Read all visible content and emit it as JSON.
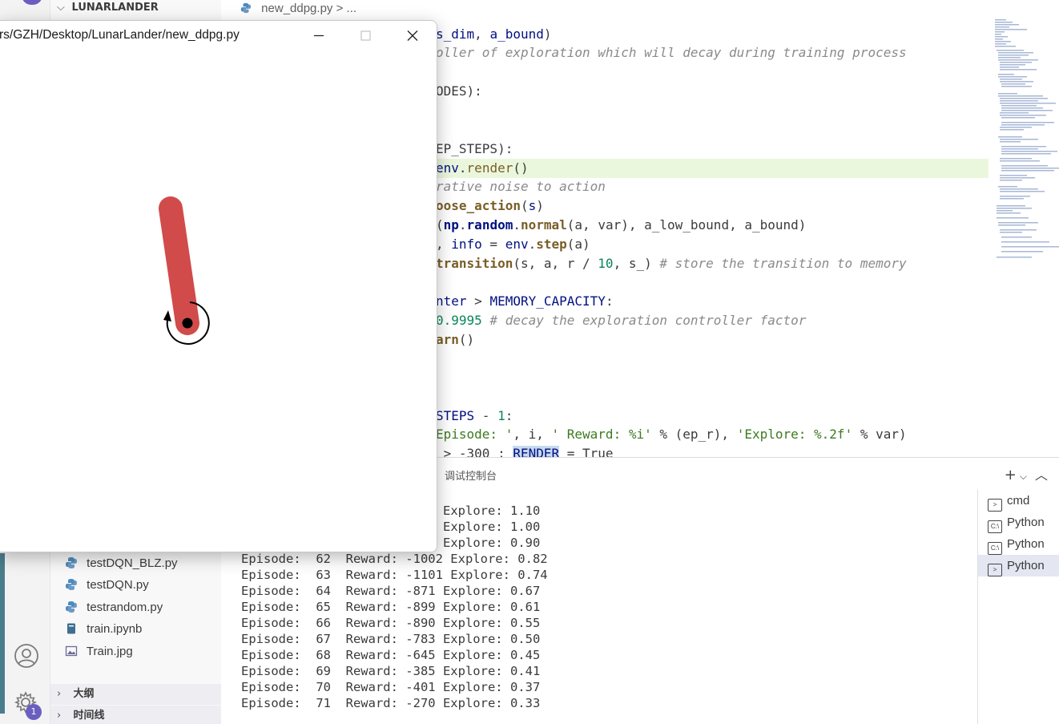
{
  "sidebar": {
    "root_folder": "LUNARLANDER",
    "files": [
      {
        "name": "testDQN_BLZ.py",
        "kind": "python"
      },
      {
        "name": "testDQN.py",
        "kind": "python"
      },
      {
        "name": "testrandom.py",
        "kind": "python"
      },
      {
        "name": "train.ipynb",
        "kind": "notebook"
      },
      {
        "name": "Train.jpg",
        "kind": "image"
      }
    ],
    "outline_label": "大纲",
    "timeline_label": "时间线"
  },
  "activity_bar": {
    "settings_badge": "1"
  },
  "editor": {
    "breadcrumb_file": "new_ddpg.py",
    "breadcrumb_sep": ">",
    "breadcrumb_more": "...",
    "lines": {
      "l1a": "s_dim",
      "l1b": ", ",
      "l1c": "a_bound",
      "l1d": ")",
      "l2": "oller of exploration which will decay during training process",
      "l3": "ODES):",
      "l4": "EP_STEPS):",
      "l5a": "env",
      "l5b": ".",
      "l5c": "render",
      "l5d": "()",
      "l6": "rative noise to action",
      "l7a": "oose_action",
      "l7b": "(",
      "l7c": "s",
      "l7d": ")",
      "l8a": "(",
      "l8b": "np",
      "l8c": ".",
      "l8d": "random",
      "l8e": ".",
      "l8f": "normal",
      "l8g": "(a, var), a_low_bound, a_bound)",
      "l9a": ", ",
      "l9b": "info",
      "l9c": " = ",
      "l9d": "env",
      "l9e": ".",
      "l9f": "step",
      "l9g": "(a)",
      "l10a": "transition",
      "l10b": "(s, a, r / ",
      "l10c": "10",
      "l10d": ", s_) ",
      "l10e": "# store the transition to memory",
      "l11a": "nter",
      "l11b": " > ",
      "l11c": "MEMORY_CAPACITY",
      "l11d": ":",
      "l12a": "0.9995",
      "l12b": " # decay the exploration controller factor",
      "l13a": "arn",
      "l13b": "()",
      "l14a": "STEPS",
      "l14b": " - ",
      "l14c": "1",
      "l14d": ":",
      "l15a": "Episode: '",
      "l15b": ", i, ",
      "l15c": "' Reward: %i'",
      "l15d": " % (ep_r), ",
      "l15e": "'Explore: %.2f'",
      "l15f": " % var)",
      "l16a": " > -300 : ",
      "l16b": "RENDER",
      "l16c": " = True"
    }
  },
  "panel": {
    "title": "调试控制台",
    "add_icon": "+",
    "terminals": [
      {
        "label": "cmd",
        "glyph": ">"
      },
      {
        "label": "Python",
        "glyph": "C:\\"
      },
      {
        "label": "Python",
        "glyph": "C:\\"
      },
      {
        "label": "Python",
        "glyph": ">",
        "active": true
      }
    ],
    "output": [
      {
        "text": "Explore: 1.10"
      },
      {
        "text": "Explore: 1.00"
      },
      {
        "text": "Explore: 0.90"
      },
      {
        "text": "Episode:  62  Reward: -1002 Explore: 0.82"
      },
      {
        "text": "Episode:  63  Reward: -1101 Explore: 0.74"
      },
      {
        "text": "Episode:  64  Reward: -871 Explore: 0.67"
      },
      {
        "text": "Episode:  65  Reward: -899 Explore: 0.61"
      },
      {
        "text": "Episode:  66  Reward: -890 Explore: 0.55"
      },
      {
        "text": "Episode:  67  Reward: -783 Explore: 0.50"
      },
      {
        "text": "Episode:  68  Reward: -645 Explore: 0.45"
      },
      {
        "text": "Episode:  69  Reward: -385 Explore: 0.41"
      },
      {
        "text": "Episode:  70  Reward: -401 Explore: 0.37"
      },
      {
        "text": "Episode:  71  Reward: -270 Explore: 0.33"
      }
    ]
  },
  "render_window": {
    "title": "rs/GZH/Desktop/LunarLander/new_ddpg.py",
    "pole_color": "#d14b4b"
  }
}
